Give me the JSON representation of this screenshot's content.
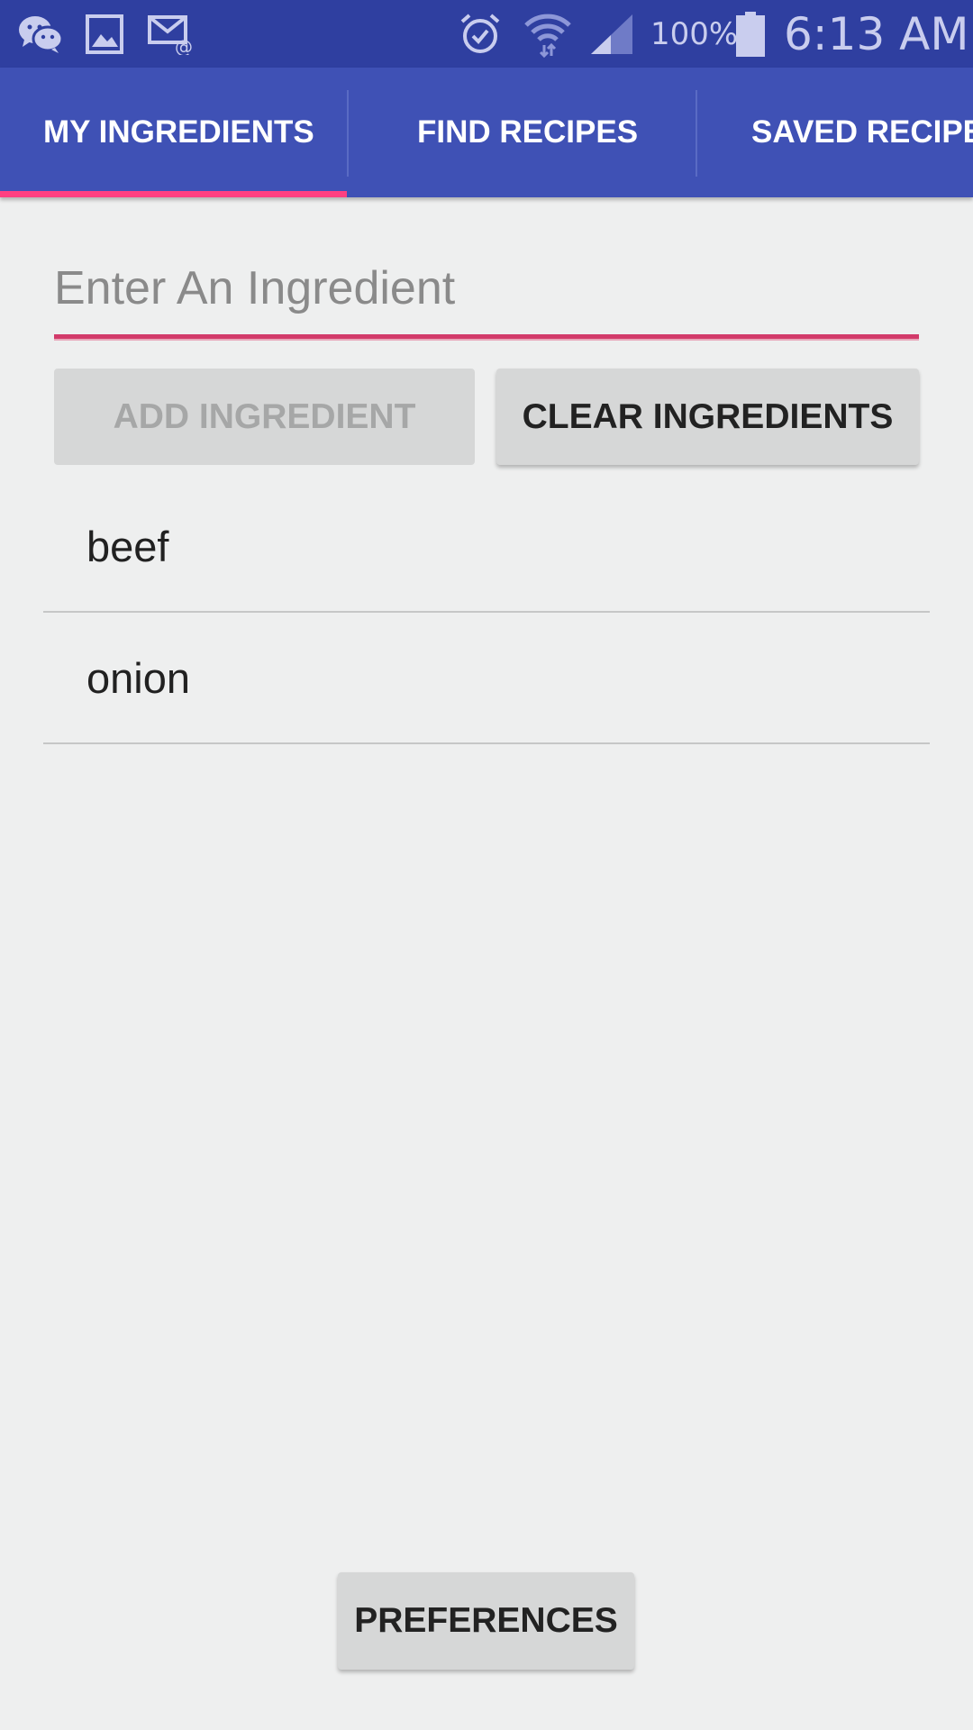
{
  "status_bar": {
    "battery_text": "100%",
    "time": "6:13 AM",
    "icons": [
      "wechat-icon",
      "gallery-icon",
      "email-icon",
      "alarm-icon",
      "wifi-icon",
      "signal-icon",
      "battery-icon"
    ]
  },
  "tabs": [
    {
      "label": "MY INGREDIENTS",
      "selected": true
    },
    {
      "label": "FIND RECIPES",
      "selected": false
    },
    {
      "label": "SAVED RECIPES",
      "selected": false
    }
  ],
  "ingredient_input": {
    "value": "",
    "placeholder": "Enter An Ingredient"
  },
  "buttons": {
    "add_label": "ADD INGREDIENT",
    "clear_label": "CLEAR INGREDIENTS",
    "preferences_label": "PREFERENCES"
  },
  "ingredients": [
    "beef",
    "onion"
  ],
  "colors": {
    "status_bar": "#2f3fa0",
    "app_bar": "#3f51b5",
    "accent": "#ff4081",
    "background": "#eeefef"
  }
}
